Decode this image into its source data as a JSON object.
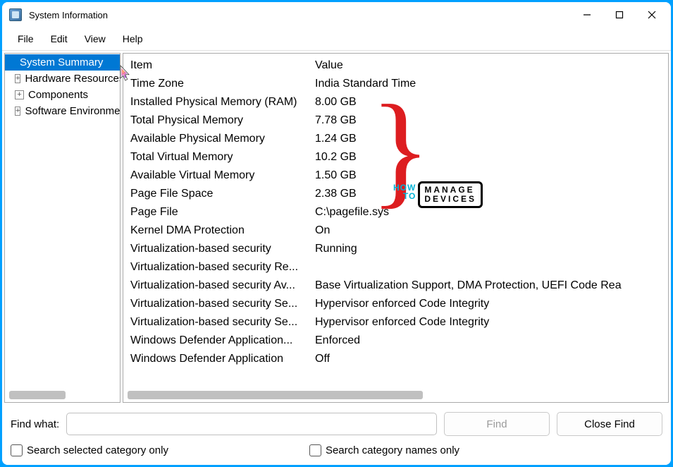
{
  "window": {
    "title": "System Information"
  },
  "menubar": {
    "items": [
      "File",
      "Edit",
      "View",
      "Help"
    ]
  },
  "tree": {
    "items": [
      {
        "label": "System Summary",
        "selected": true,
        "expandable": false
      },
      {
        "label": "Hardware Resources",
        "selected": false,
        "expandable": true
      },
      {
        "label": "Components",
        "selected": false,
        "expandable": true
      },
      {
        "label": "Software Environment",
        "selected": false,
        "expandable": true
      }
    ]
  },
  "grid": {
    "headers": {
      "item": "Item",
      "value": "Value"
    },
    "rows": [
      {
        "item": "Time Zone",
        "value": "India Standard Time"
      },
      {
        "item": "Installed Physical Memory (RAM)",
        "value": "8.00 GB"
      },
      {
        "item": "Total Physical Memory",
        "value": "7.78 GB"
      },
      {
        "item": "Available Physical Memory",
        "value": "1.24 GB"
      },
      {
        "item": "Total Virtual Memory",
        "value": "10.2 GB"
      },
      {
        "item": "Available Virtual Memory",
        "value": "1.50 GB"
      },
      {
        "item": "Page File Space",
        "value": "2.38 GB"
      },
      {
        "item": "Page File",
        "value": "C:\\pagefile.sys"
      },
      {
        "item": "Kernel DMA Protection",
        "value": "On"
      },
      {
        "item": "Virtualization-based security",
        "value": "Running"
      },
      {
        "item": "Virtualization-based security Re...",
        "value": ""
      },
      {
        "item": "Virtualization-based security Av...",
        "value": "Base Virtualization Support, DMA Protection, UEFI Code Rea"
      },
      {
        "item": "Virtualization-based security Se...",
        "value": "Hypervisor enforced Code Integrity"
      },
      {
        "item": "Virtualization-based security Se...",
        "value": "Hypervisor enforced Code Integrity"
      },
      {
        "item": "Windows Defender Application...",
        "value": "Enforced"
      },
      {
        "item": "Windows Defender Application",
        "value": "Off"
      }
    ]
  },
  "find": {
    "label": "Find what:",
    "value": "",
    "find_button": "Find",
    "close_button": "Close Find",
    "chk_selected": "Search selected category only",
    "chk_names": "Search category names only"
  },
  "watermark": {
    "how": "HOW",
    "to": "TO",
    "manage": "MANAGE",
    "devices": "DEVICES"
  }
}
